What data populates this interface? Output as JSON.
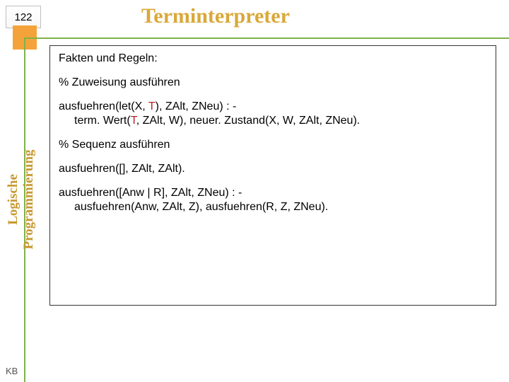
{
  "page_number": "122",
  "title": "Terminterpreter",
  "sidebar_label": "Logische Programmierung",
  "footer_mark": "KB",
  "colors": {
    "title": "#d9a83a",
    "accent": "#f4a33a",
    "lines": "#7fb24a",
    "term_color": "#b02222"
  },
  "content": {
    "heading": "Fakten und Regeln:",
    "c1": "% Zuweisung ausführen",
    "rule1_a": "ausfuehren(let(X, ",
    "rule1_T1": "T",
    "rule1_b": "), ZAlt, ZNeu) : -",
    "rule1_c": "term. Wert(",
    "rule1_T2": "T",
    "rule1_d": ", ZAlt, W), neuer. Zustand(X, W, ZAlt, ZNeu).",
    "c2": "% Sequenz ausführen",
    "fact1": "ausfuehren([], ZAlt, ZAlt).",
    "rule2_a": "ausfuehren([Anw | R], ZAlt, ZNeu) : -",
    "rule2_b": "ausfuehren(Anw, ZAlt, Z), ausfuehren(R, Z, ZNeu)."
  }
}
